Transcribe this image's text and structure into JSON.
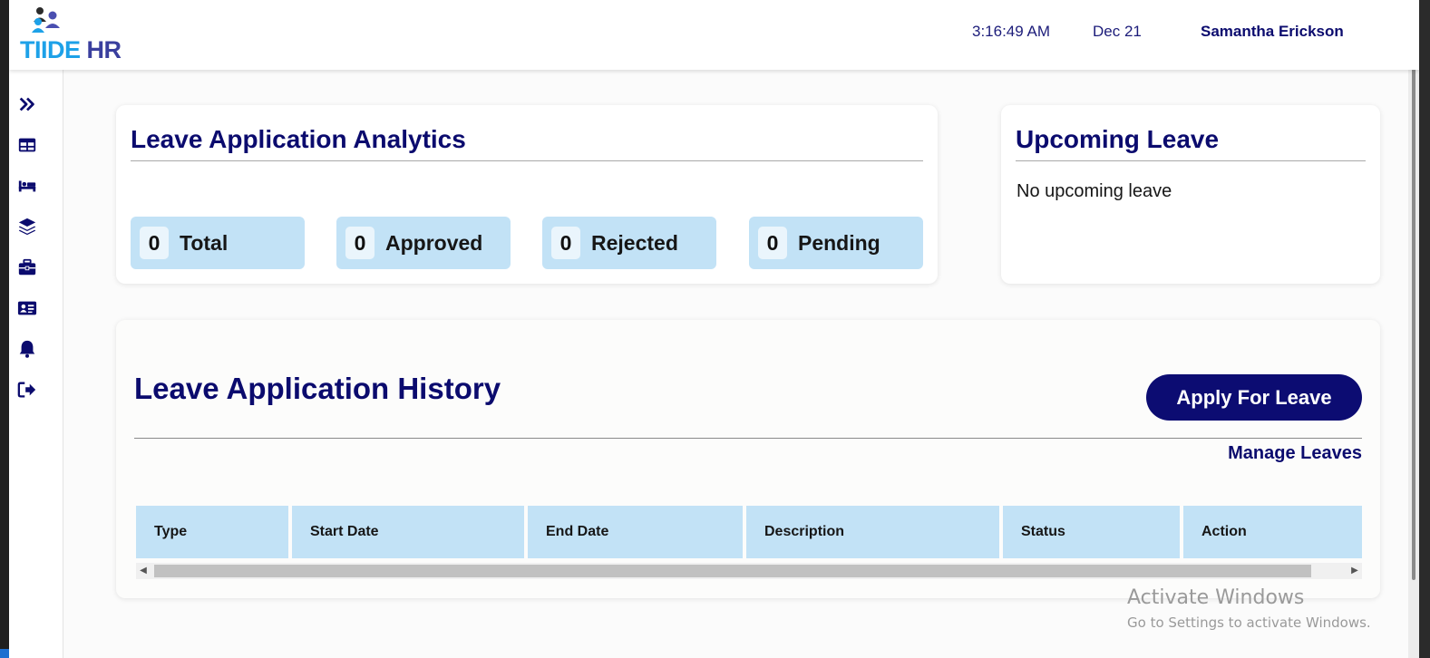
{
  "header": {
    "logo_text_a": "TIIDE",
    "logo_text_b": "HR",
    "time": "3:16:49 AM",
    "date": "Dec 21",
    "user_name": "Samantha Erickson"
  },
  "sidebar": {
    "items": [
      {
        "icon": "double-chevron-right-icon"
      },
      {
        "icon": "table-icon"
      },
      {
        "icon": "bed-icon"
      },
      {
        "icon": "layers-icon"
      },
      {
        "icon": "briefcase-icon"
      },
      {
        "icon": "id-card-icon"
      },
      {
        "icon": "bell-icon"
      },
      {
        "icon": "sign-out-icon"
      }
    ]
  },
  "analytics": {
    "title": "Leave Application Analytics",
    "stats": [
      {
        "count": "0",
        "label": "Total"
      },
      {
        "count": "0",
        "label": "Approved"
      },
      {
        "count": "0",
        "label": "Rejected"
      },
      {
        "count": "0",
        "label": "Pending"
      }
    ]
  },
  "upcoming": {
    "title": "Upcoming Leave",
    "empty_text": "No upcoming leave"
  },
  "history": {
    "title": "Leave Application History",
    "apply_button": "Apply For Leave",
    "manage_link": "Manage Leaves",
    "columns": [
      "Type",
      "Start Date",
      "End Date",
      "Description",
      "Status",
      "Action"
    ]
  },
  "watermark": {
    "line1": "Activate Windows",
    "line2": "Go to Settings to activate Windows."
  },
  "colors": {
    "brand_navy": "#0b0b6e",
    "light_blue": "#c2e2f6",
    "logo_cyan": "#1da1e8"
  }
}
